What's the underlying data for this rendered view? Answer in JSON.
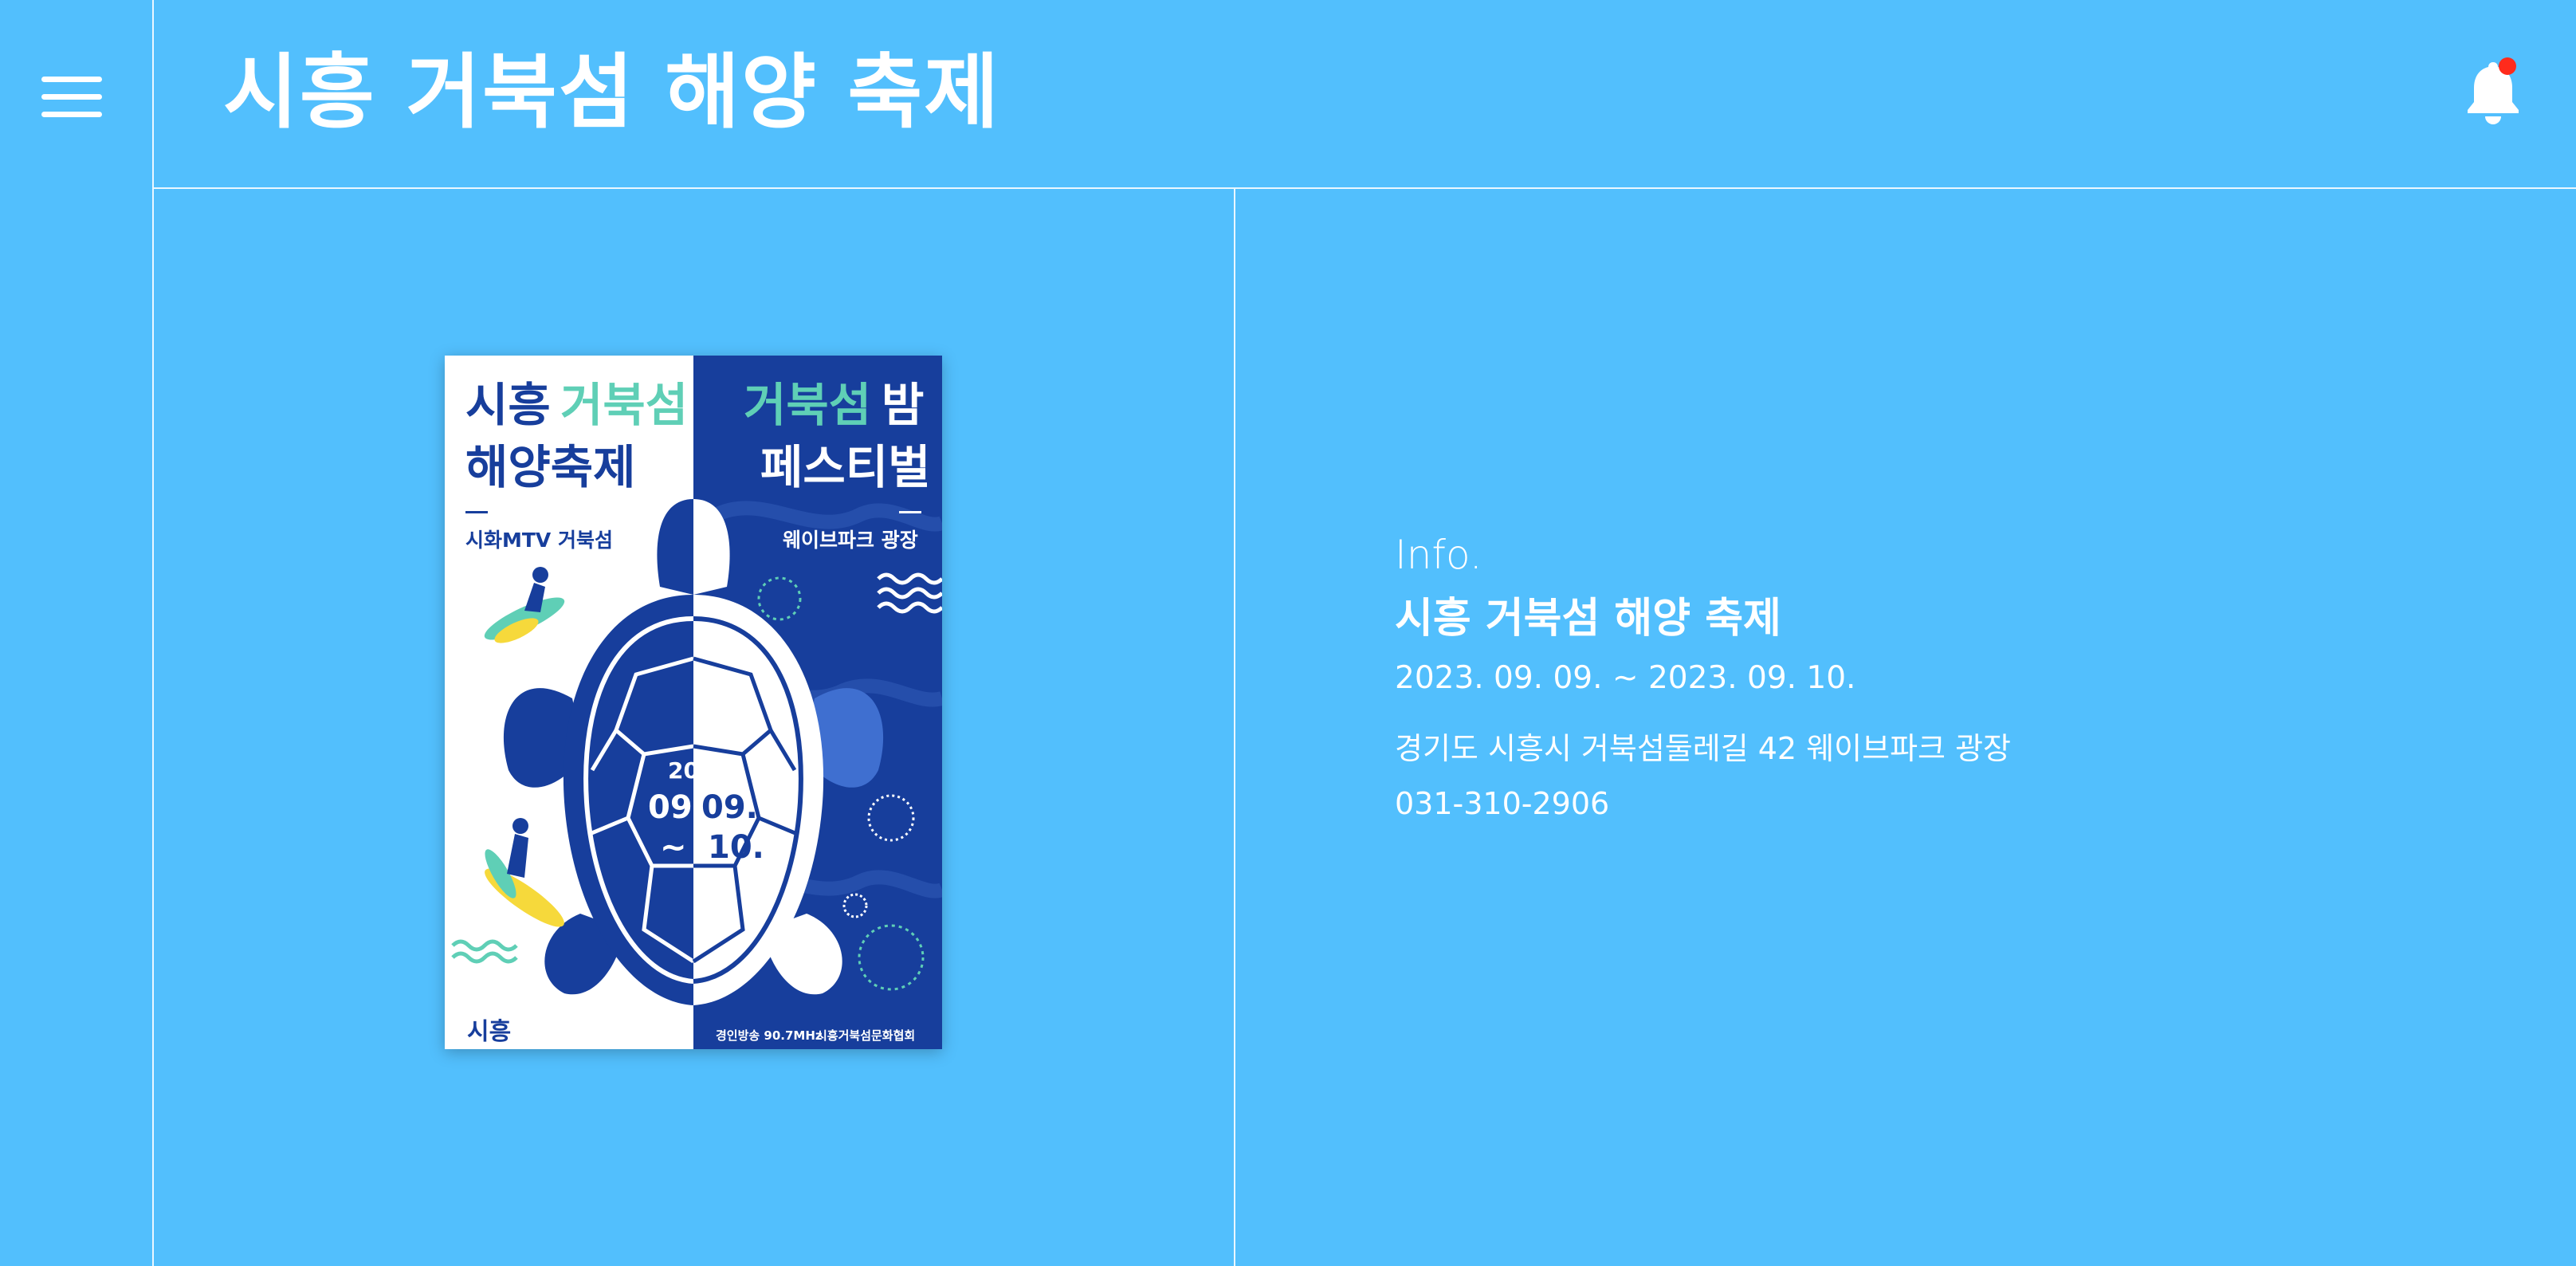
{
  "header": {
    "title": "시흥 거북섬 해양 축제",
    "menu_icon": "hamburger-menu-icon",
    "notification_icon": "bell-icon",
    "notification_dot_color": "#ff2b1c"
  },
  "poster": {
    "left_title_line1_a": "시흥",
    "left_title_line1_b": "거북섬",
    "left_title_line2": "해양축제",
    "left_subtitle": "시화MTV 거북섬",
    "right_title_line1_a": "거북섬",
    "right_title_line1_b": "밤",
    "right_title_line2": "페스티벌",
    "right_subtitle": "웨이브파크 광장",
    "year": "2023",
    "date_left": "09.",
    "date_right_top": "09.",
    "tilde": "~",
    "date_right_bottom": "10.",
    "logo_text": "시흥",
    "sponsor_1": "경인방송 90.7MHz",
    "sponsor_2": "시흥거북섬문화협회"
  },
  "info": {
    "label": "Info.",
    "title": "시흥 거북섬 해양 축제",
    "date_range": "2023. 09. 09. ~ 2023. 09. 10.",
    "address": "경기도 시흥시 거북섬둘레길 42 웨이브파크 광장",
    "phone": "031-310-2906"
  },
  "colors": {
    "background": "#52bffd",
    "text": "#ffffff",
    "divider": "#eaf7ff",
    "poster_navy": "#173e9c",
    "poster_mint": "#5fcfb6"
  }
}
